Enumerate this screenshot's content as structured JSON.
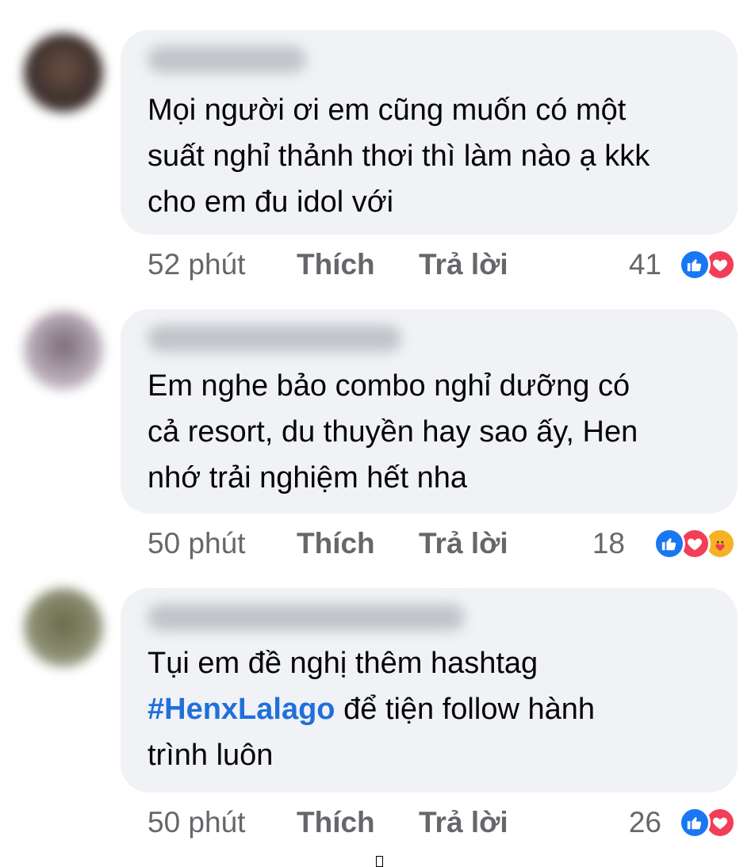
{
  "comments": [
    {
      "lines": [
        "Mọi người ơi em cũng muốn có một",
        "suất nghỉ thảnh thơi thì làm nào ạ kkk",
        "cho em đu idol với"
      ],
      "time": "52 phút",
      "like_label": "Thích",
      "reply_label": "Trả lời",
      "reaction_count": "41",
      "reactions": [
        "like-icon",
        "love-icon"
      ]
    },
    {
      "lines": [
        "Em nghe bảo combo nghỉ dưỡng có",
        "cả resort, du thuyền hay sao ấy, Hen",
        "nhớ trải nghiệm hết nha"
      ],
      "time": "50 phút",
      "like_label": "Thích",
      "reply_label": "Trả lời",
      "reaction_count": "18",
      "reactions": [
        "like-icon",
        "love-icon",
        "care-icon"
      ]
    },
    {
      "line1": "Tụi em đề nghị thêm hashtag",
      "hashtag": "#HenxLalago",
      "line2_rest": " để tiện follow hành",
      "line3": "trình luôn",
      "time": "50 phút",
      "like_label": "Thích",
      "reply_label": "Trả lời",
      "reaction_count": "26",
      "reactions": [
        "like-icon",
        "love-icon"
      ]
    }
  ],
  "colors": {
    "bubble": "#f0f2f5",
    "meta_text": "#65676b",
    "hashtag": "#216fdb",
    "like": "#1877f2",
    "love": "#f33e58",
    "care": "#f7b125"
  }
}
